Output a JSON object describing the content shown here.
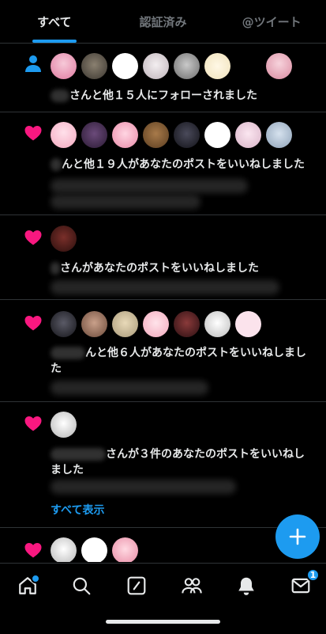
{
  "tabs": [
    {
      "label": "すべて"
    },
    {
      "label": "認証済み"
    },
    {
      "label": "@ツイート"
    }
  ],
  "notifications": [
    {
      "icon": "person-icon",
      "text": "さんと他１５人にフォローされました"
    },
    {
      "icon": "heart-icon",
      "text": "んと他１９人があなたのポストをいいねしました"
    },
    {
      "icon": "heart-icon",
      "text": "さんがあなたのポストをいいねしました"
    },
    {
      "icon": "heart-icon",
      "text": "んと他６人があなたのポストをいいねしました"
    },
    {
      "icon": "heart-icon",
      "text": "さんが３件のあなたのポストをいいねしました",
      "show_all": "すべて表示"
    },
    {
      "icon": "heart-icon"
    }
  ],
  "nav": {
    "items": [
      "home-icon",
      "search-icon",
      "communities-icon",
      "people-icon",
      "bell-icon",
      "mail-icon"
    ],
    "messages_badge": "1"
  },
  "colors": {
    "accent": "#1d9bf0",
    "like": "#f91880",
    "follow": "#1d9bf0",
    "background": "#000000"
  }
}
